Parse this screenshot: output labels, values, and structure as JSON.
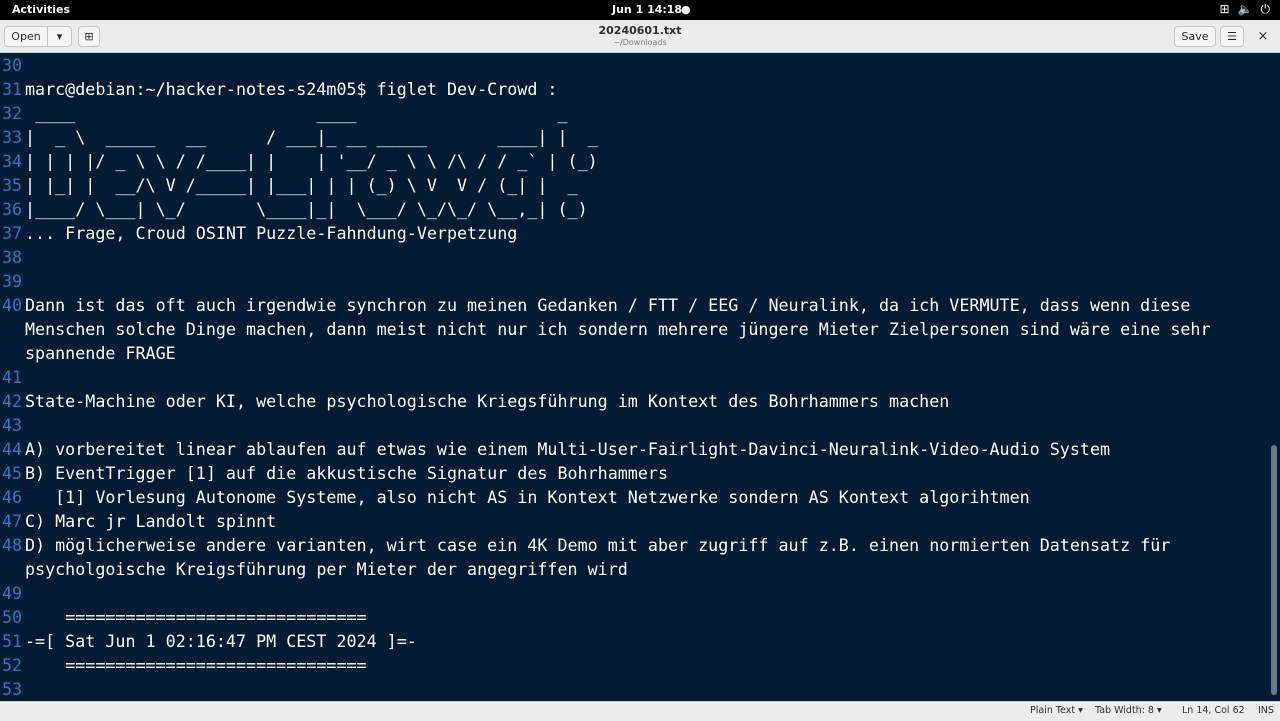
{
  "topbar": {
    "activities": "Activities",
    "clock": "Jun 1  14:18",
    "dot": "●",
    "tray_icons": [
      "network-icon",
      "volume-icon",
      "power-icon"
    ],
    "tray_glyphs": [
      "⊞",
      "🔈",
      "⏻"
    ]
  },
  "header": {
    "open_label": "Open",
    "open_menu_glyph": "▾",
    "newtab_glyph": "⊞",
    "title": "20240601.txt",
    "subtitle": "~/Downloads",
    "save_label": "Save",
    "menu_glyph": "☰",
    "close_glyph": "×"
  },
  "editor": {
    "lines": [
      {
        "num": "30",
        "text": ""
      },
      {
        "num": "31",
        "text": "marc@debian:~/hacker-notes-s24m05$ figlet Dev-Crowd :"
      },
      {
        "num": "32",
        "text": " ____                        ____                    _"
      },
      {
        "num": "33",
        "text": "|  _ \\  _____   __      / ___|_ __ _____       ____| |  _"
      },
      {
        "num": "34",
        "text": "| | | |/ _ \\ \\ / /____| |    | '__/ _ \\ \\ /\\ / / _` | (_)"
      },
      {
        "num": "35",
        "text": "| |_| |  __/\\ V /_____| |___| | | (_) \\ V  V / (_| |  _"
      },
      {
        "num": "36",
        "text": "|____/ \\___| \\_/       \\____|_|  \\___/ \\_/\\_/ \\__,_| (_)"
      },
      {
        "num": "37",
        "text": "... Frage, Croud OSINT Puzzle-Fahndung-Verpetzung"
      },
      {
        "num": "38",
        "text": ""
      },
      {
        "num": "39",
        "text": ""
      },
      {
        "num": "40",
        "text": "Dann ist das oft auch irgendwie synchron zu meinen Gedanken / FTT / EEG / Neuralink, da ich VERMUTE, dass wenn diese Menschen solche Dinge machen, dann meist nicht nur ich sondern mehrere jüngere Mieter Zielpersonen sind wäre eine sehr spannende FRAGE"
      },
      {
        "num": "41",
        "text": ""
      },
      {
        "num": "42",
        "text": "State-Machine oder KI, welche psychologische Kriegsführung im Kontext des Bohrhammers machen"
      },
      {
        "num": "43",
        "text": ""
      },
      {
        "num": "44",
        "text": "A) vorbereitet linear ablaufen auf etwas wie einem Multi-User-Fairlight-Davinci-Neuralink-Video-Audio System"
      },
      {
        "num": "45",
        "text": "B) EventTrigger [1] auf die akkustische Signatur des Bohrhammers"
      },
      {
        "num": "46",
        "text": "   [1] Vorlesung Autonome Systeme, also nicht AS in Kontext Netzwerke sondern AS Kontext algorihtmen"
      },
      {
        "num": "47",
        "text": "C) Marc jr Landolt spinnt"
      },
      {
        "num": "48",
        "text": "D) möglicherweise andere varianten, wirt case ein 4K Demo mit aber zugriff auf z.B. einen normierten Datensatz für psycholgoische Kreigsführung per Mieter der angegriffen wird"
      },
      {
        "num": "49",
        "text": ""
      },
      {
        "num": "50",
        "text": "    =============================="
      },
      {
        "num": "51",
        "text": "-=[ Sat Jun 1 02:16:47 PM CEST 2024 ]=-"
      },
      {
        "num": "52",
        "text": "    =============================="
      },
      {
        "num": "53",
        "text": ""
      }
    ]
  },
  "statusbar": {
    "language": "Plain Text ▾",
    "tab_width": "Tab Width: 8 ▾",
    "position": "Ln 14, Col 62",
    "mode": "INS"
  }
}
